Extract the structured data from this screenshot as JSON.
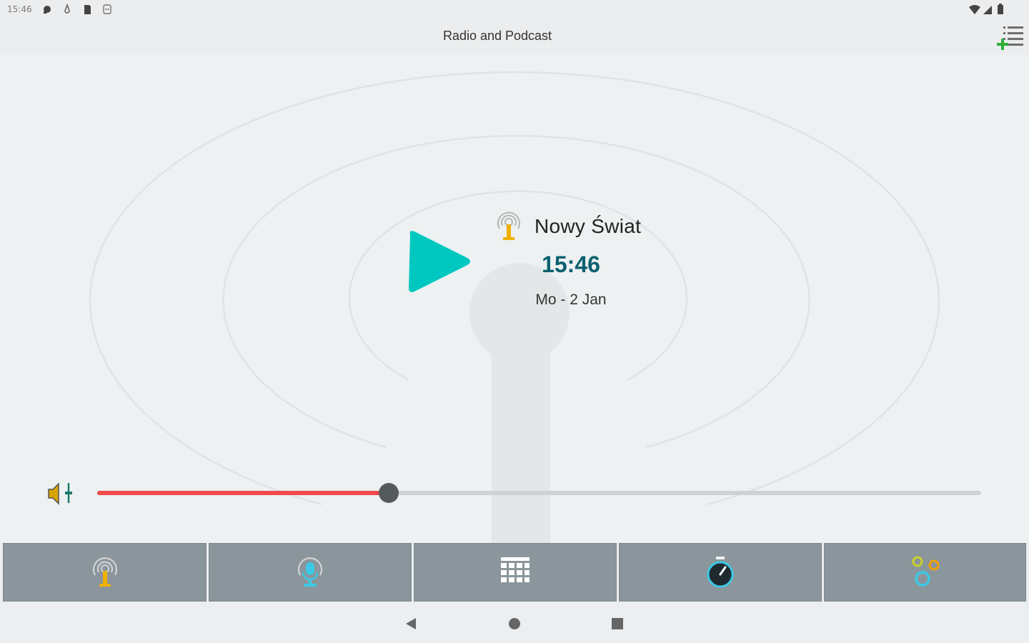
{
  "status_bar": {
    "time": "15:46",
    "icons": [
      "notification-icon",
      "drop-icon",
      "sd-card-icon",
      "storage-icon"
    ],
    "right_icons": [
      "wifi-icon",
      "signal-icon",
      "battery-icon"
    ]
  },
  "app_bar": {
    "title": "Radio and Podcast",
    "action_icon": "add-to-list-icon"
  },
  "player": {
    "play_icon": "play-icon",
    "station_icon": "radio-tower-icon",
    "station_name": "Nowy Świat",
    "clock": "15:46",
    "date": "Mo - 2 Jan",
    "volume_level": 0.33
  },
  "tabs": [
    {
      "name": "tab-radio",
      "icon": "radio-tower-icon"
    },
    {
      "name": "tab-podcast",
      "icon": "podcast-microphone-icon"
    },
    {
      "name": "tab-grid",
      "icon": "grid-icon"
    },
    {
      "name": "tab-timer",
      "icon": "stopwatch-icon"
    },
    {
      "name": "tab-settings",
      "icon": "circles-icon"
    }
  ],
  "nav_bar": {
    "back": "back-icon",
    "home": "home-icon",
    "recents": "recents-icon"
  },
  "colors": {
    "accent": "#00c8c0",
    "clock": "#0c6170",
    "volume_fill": "#f04a4a",
    "tab_bg": "#8a969c",
    "tower": "#f0b000",
    "podcast": "#3cc8e6"
  }
}
